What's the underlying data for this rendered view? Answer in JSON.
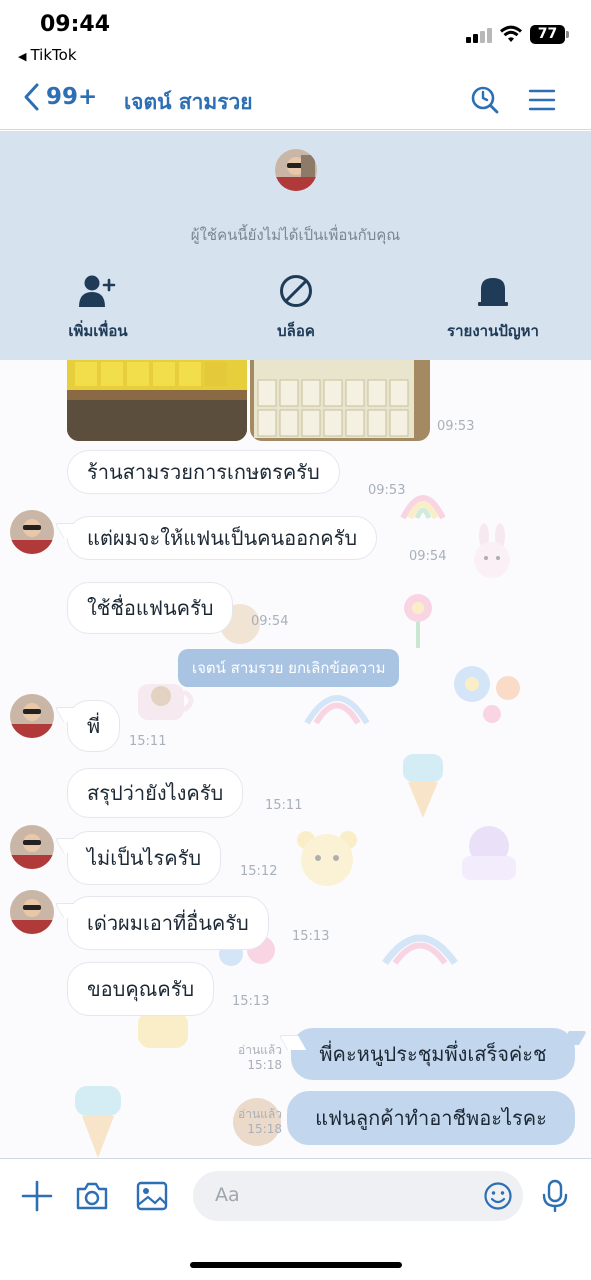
{
  "status_bar": {
    "time": "09:44",
    "back_app": "TikTok",
    "battery": "77"
  },
  "header": {
    "back_count": "99+",
    "title": "เจตน์ สามรวย"
  },
  "banner": {
    "notice": "ผู้ใช้คนนี้ยังไม่ได้เป็นเพื่อนกับคุณ",
    "actions": [
      {
        "label": "เพิ่มเพื่อน",
        "icon": "add-friend-icon"
      },
      {
        "label": "บล็อค",
        "icon": "block-icon"
      },
      {
        "label": "รายงานปัญหา",
        "icon": "report-icon"
      }
    ]
  },
  "messages": [
    {
      "time": "09:53"
    },
    {
      "text": "ร้านสามรวยการเกษตรครับ",
      "time": "09:53"
    },
    {
      "text": "แต่ผมจะให้แฟนเป็นคนออกครับ",
      "time": "09:54"
    },
    {
      "text": "ใช้ชื่อแฟนครับ",
      "time": "09:54"
    },
    {
      "text": "พี่",
      "time": "15:11"
    },
    {
      "text": "สรุปว่ายังไงครับ",
      "time": "15:11"
    },
    {
      "text": "ไม่เป็นไรครับ",
      "time": "15:12"
    },
    {
      "text": "เด่วผมเอาที่อื่นครับ",
      "time": "15:13"
    },
    {
      "text": "ขอบคุณครับ",
      "time": "15:13"
    },
    {
      "text": "พี่คะหนูประชุมพึ่งเสร็จค่ะช",
      "time": "15:18",
      "read": "อ่านแล้ว"
    },
    {
      "text": "แฟนลูกค้าทำอาชีพอะไรคะ",
      "time": "15:18",
      "read": "อ่านแล้ว"
    }
  ],
  "system_message": "เจตน์ สามรวย ยกเลิกข้อความ",
  "input": {
    "placeholder": "Aa"
  },
  "colors": {
    "accent": "#2c6fb4",
    "banner_bg": "#d6e2ee",
    "my_bubble": "#c2d7ee"
  }
}
